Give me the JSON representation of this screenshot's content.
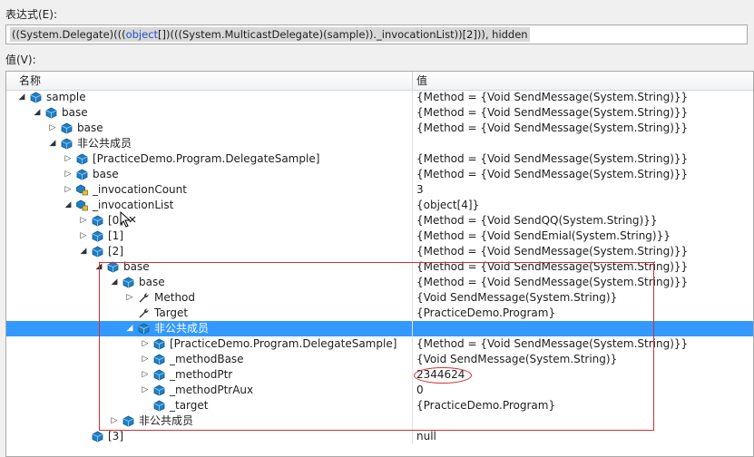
{
  "expression": {
    "label": "表达式(E):",
    "prefix": "((System.Delegate)(((",
    "keyword": "object",
    "suffix": "[])(((System.MulticastDelegate)(sample))._invocationList))[2])), hidden"
  },
  "value_label": "值(V):",
  "columns": {
    "name": "名称",
    "value": "值"
  },
  "rows": [
    {
      "name": "sample",
      "value": "{Method = {Void SendMessage(System.String)}}",
      "indent": 0,
      "expander": "open",
      "icon": "object-icon",
      "selected": false
    },
    {
      "name": "base",
      "value": "{Method = {Void SendMessage(System.String)}}",
      "indent": 1,
      "expander": "open",
      "icon": "object-icon",
      "selected": false
    },
    {
      "name": "base",
      "value": "{Method = {Void SendMessage(System.String)}}",
      "indent": 2,
      "expander": "closed",
      "icon": "object-icon",
      "selected": false
    },
    {
      "name": "非公共成员",
      "value": "",
      "indent": 2,
      "expander": "open",
      "icon": "object-icon",
      "selected": false
    },
    {
      "name": "[PracticeDemo.Program.DelegateSample]",
      "value": "{Method = {Void SendMessage(System.String)}}",
      "indent": 3,
      "expander": "closed",
      "icon": "object-icon",
      "selected": false
    },
    {
      "name": "base",
      "value": "{Method = {Void SendMessage(System.String)}}",
      "indent": 3,
      "expander": "closed",
      "icon": "object-icon",
      "selected": false
    },
    {
      "name": "_invocationCount",
      "value": "3",
      "indent": 3,
      "expander": "closed",
      "icon": "private-field-icon",
      "selected": false
    },
    {
      "name": "_invocationList",
      "value": "{object[4]}",
      "indent": 3,
      "expander": "open",
      "icon": "private-field-icon",
      "selected": false
    },
    {
      "name": "[0]",
      "value": "{Method = {Void SendQQ(System.String)}}",
      "indent": 4,
      "expander": "closed",
      "icon": "object-icon",
      "selected": false
    },
    {
      "name": "[1]",
      "value": "{Method = {Void SendEmial(System.String)}}",
      "indent": 4,
      "expander": "closed",
      "icon": "object-icon",
      "selected": false
    },
    {
      "name": "[2]",
      "value": "{Method = {Void SendMessage(System.String)}}",
      "indent": 4,
      "expander": "open",
      "icon": "object-icon",
      "selected": false
    },
    {
      "name": "base",
      "value": "{Method = {Void SendMessage(System.String)}}",
      "indent": 5,
      "expander": "open",
      "icon": "object-icon",
      "selected": false
    },
    {
      "name": "base",
      "value": "{Method = {Void SendMessage(System.String)}}",
      "indent": 6,
      "expander": "open",
      "icon": "object-icon",
      "selected": false
    },
    {
      "name": "Method",
      "value": "{Void SendMessage(System.String)}",
      "indent": 7,
      "expander": "closed",
      "icon": "wrench-icon",
      "selected": false
    },
    {
      "name": "Target",
      "value": "{PracticeDemo.Program}",
      "indent": 7,
      "expander": "none",
      "icon": "wrench-icon",
      "selected": false
    },
    {
      "name": "非公共成员",
      "value": "",
      "indent": 7,
      "expander": "open",
      "icon": "object-icon",
      "selected": true
    },
    {
      "name": "[PracticeDemo.Program.DelegateSample]",
      "value": "{Method = {Void SendMessage(System.String)}}",
      "indent": 8,
      "expander": "closed",
      "icon": "object-icon",
      "selected": false
    },
    {
      "name": "_methodBase",
      "value": "{Void SendMessage(System.String)}",
      "indent": 8,
      "expander": "closed",
      "icon": "object-icon",
      "selected": false
    },
    {
      "name": "_methodPtr",
      "value": "2344624",
      "indent": 8,
      "expander": "closed",
      "icon": "object-icon",
      "selected": false
    },
    {
      "name": "_methodPtrAux",
      "value": "0",
      "indent": 8,
      "expander": "closed",
      "icon": "object-icon",
      "selected": false
    },
    {
      "name": "_target",
      "value": "{PracticeDemo.Program}",
      "indent": 8,
      "expander": "none",
      "icon": "object-icon",
      "selected": false
    },
    {
      "name": "非公共成员",
      "value": "",
      "indent": 6,
      "expander": "closed",
      "icon": "object-icon",
      "selected": false
    },
    {
      "name": "[3]",
      "value": "null",
      "indent": 4,
      "expander": "none",
      "icon": "object-icon",
      "selected": false
    }
  ]
}
